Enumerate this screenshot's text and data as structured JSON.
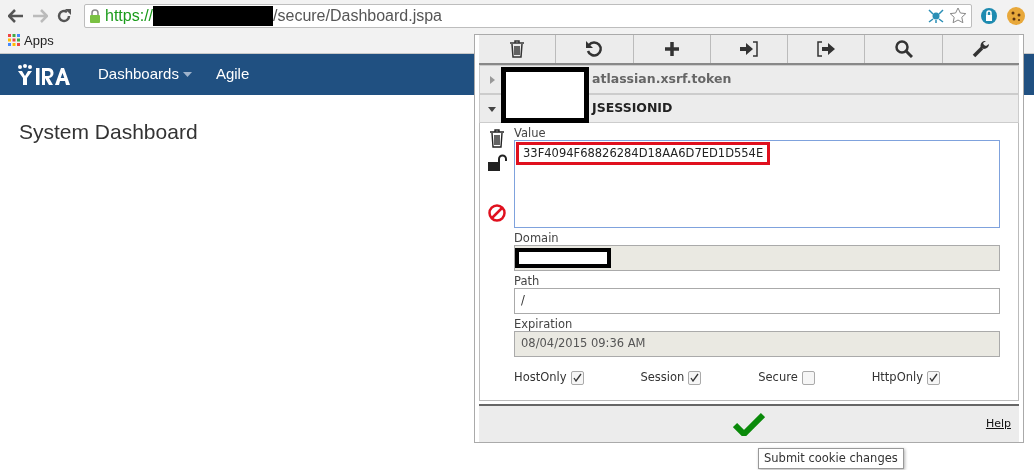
{
  "browser": {
    "url_scheme": "https://",
    "url_redacted": true,
    "url_path": "/secure/Dashboard.jspa",
    "bookmarks": [
      "Apps"
    ]
  },
  "app": {
    "nav": [
      {
        "label": "Dashboards",
        "dropdown": true
      },
      {
        "label": "Agile",
        "dropdown": false
      }
    ],
    "page_title": "System Dashboard"
  },
  "cookie_editor": {
    "cookies": [
      {
        "name": "atlassian.xsrf.token",
        "expanded": false
      },
      {
        "name": "JSESSIONID",
        "expanded": true
      }
    ],
    "fields": [
      {
        "label": "Value",
        "kind": "textarea",
        "value": "33F4094F68826284D18AA6D7ED1D554E",
        "disabled": false,
        "highlighted": true
      },
      {
        "label": "Domain",
        "kind": "input",
        "disabled": true,
        "redacted": true
      },
      {
        "label": "Path",
        "kind": "input",
        "value": "/",
        "disabled": false
      },
      {
        "label": "Expiration",
        "kind": "input",
        "value": "08/04/2015 09:36 AM",
        "disabled": true
      }
    ],
    "flags": [
      {
        "label": "HostOnly",
        "checked": true
      },
      {
        "label": "Session",
        "checked": true
      },
      {
        "label": "Secure",
        "checked": false
      },
      {
        "label": "HttpOnly",
        "checked": true
      }
    ],
    "help": "Help",
    "tooltip": "Submit cookie changes"
  }
}
